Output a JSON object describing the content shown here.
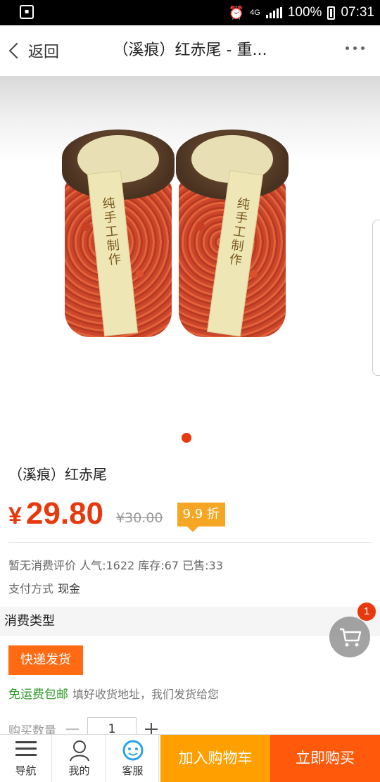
{
  "status_bar": {
    "network": "4G",
    "battery": "100%",
    "time": "07:31"
  },
  "header": {
    "back_label": "返回",
    "title": "（溪痕）红赤尾 - 重..."
  },
  "gallery": {
    "jar_label": "纯手工制作",
    "slide_count": 1
  },
  "product": {
    "name": "（溪痕）红赤尾",
    "currency": "¥",
    "price": "29.80",
    "old_price": "¥30.00",
    "discount": "9.9 折",
    "stats": "暂无消费评价 人气:1622 库存:67 已售:33",
    "payment_label": "支付方式",
    "payment_value": "现金"
  },
  "consumption": {
    "section_title": "消费类型",
    "ship_option": "快递发货",
    "free_ship": "免运费包邮",
    "free_ship_note": "填好收货地址，我们发货给您"
  },
  "quantity": {
    "label": "购买数量",
    "value": "1"
  },
  "floating_cart": {
    "badge": "1"
  },
  "bottom_bar": {
    "nav_label": "导航",
    "me_label": "我的",
    "service_label": "客服",
    "add_cart_label": "加入购物车",
    "buy_now_label": "立即购买"
  },
  "colors": {
    "accent": "#e8380d",
    "cart_button": "#ff9f00",
    "buy_button": "#ff5a0c",
    "discount_tag": "#f5a623",
    "free_ship_text": "#2e9a2a"
  }
}
